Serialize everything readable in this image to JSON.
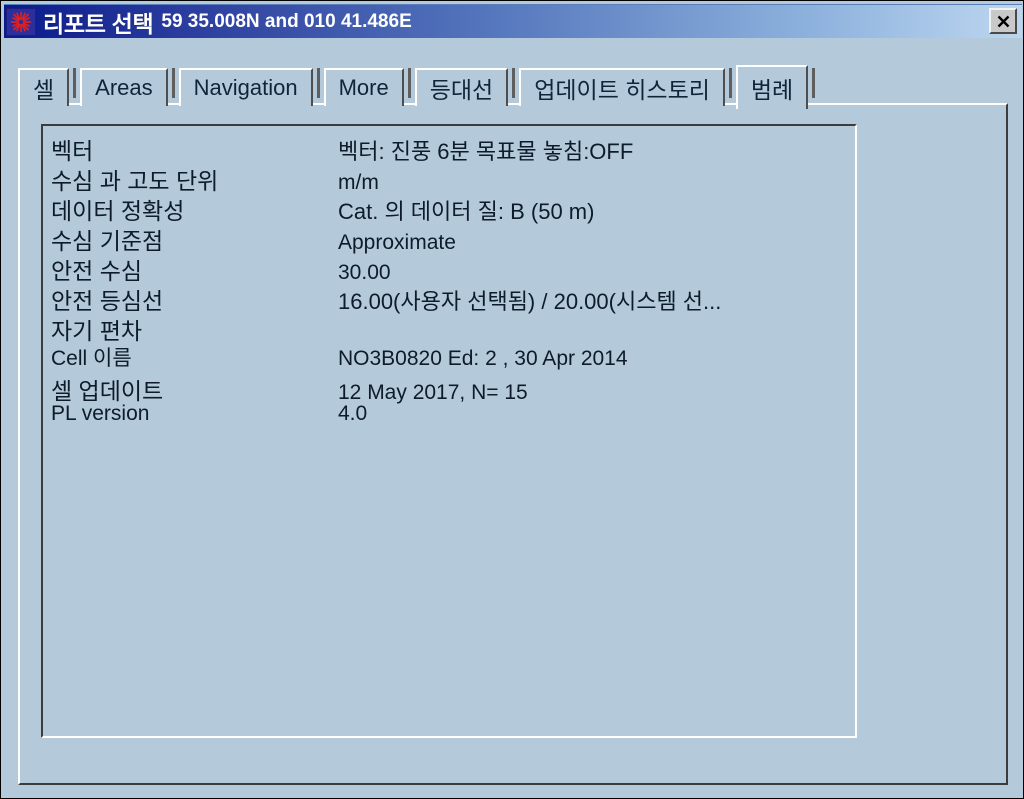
{
  "window": {
    "title": "리포트 선택",
    "coordinates": "59 35.008N and 010 41.486E",
    "app_icon": "compass-rose-icon",
    "close_label": "✕",
    "bg_color": "#b4cadb",
    "titlebar_color_start": "#0a1a8c",
    "titlebar_color_end": "#bcd6ef"
  },
  "tabs": [
    {
      "label": "셀",
      "script": "korean",
      "active": false
    },
    {
      "label": "Areas",
      "script": "latin",
      "active": false
    },
    {
      "label": "Navigation",
      "script": "latin",
      "active": false
    },
    {
      "label": "More",
      "script": "latin",
      "active": false
    },
    {
      "label": "등대선",
      "script": "korean",
      "active": false
    },
    {
      "label": "업데이트 히스토리",
      "script": "korean",
      "active": false
    },
    {
      "label": "범례",
      "script": "korean",
      "active": true
    }
  ],
  "legend": {
    "rows": [
      {
        "label": "벡터",
        "label_script": "korean",
        "value": "벡터: 진풍  6분 목표물 놓침:OFF",
        "value_script": "korean"
      },
      {
        "label": "수심 과 고도 단위",
        "label_script": "korean",
        "value": "m/m",
        "value_script": "latin"
      },
      {
        "label": "데이터 정확성",
        "label_script": "korean",
        "value": "Cat. 의 데이터 질: B (50 m)",
        "value_script": "korean"
      },
      {
        "label": "수심  기준점",
        "label_script": "korean",
        "value": "Approximate",
        "value_script": "latin"
      },
      {
        "label": "안전 수심",
        "label_script": "korean",
        "value": "30.00",
        "value_script": "latin"
      },
      {
        "label": "안전 등심선",
        "label_script": "korean",
        "value": "16.00(사용자 선택됨) / 20.00(시스템 선...",
        "value_script": "korean"
      },
      {
        "label": "자기 편차",
        "label_script": "korean",
        "value": "",
        "value_script": "latin"
      },
      {
        "label": "Cell 이름",
        "label_script": "latin",
        "value": "NO3B0820 Ed:  2 , 30 Apr 2014",
        "value_script": "latin"
      },
      {
        "label": "셀 업데이트",
        "label_script": "korean",
        "value": "12 May 2017, N= 15",
        "value_script": "latin"
      },
      {
        "label": "PL version",
        "label_script": "latin",
        "value": "4.0",
        "value_script": "latin"
      }
    ]
  }
}
